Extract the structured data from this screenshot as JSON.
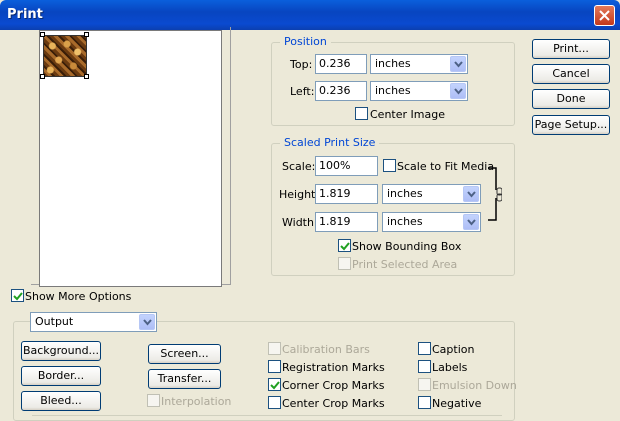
{
  "window": {
    "title": "Print"
  },
  "buttons": {
    "print": "Print...",
    "cancel": "Cancel",
    "done": "Done",
    "page_setup": "Page Setup..."
  },
  "position": {
    "title": "Position",
    "top_label": "Top:",
    "top_value": "0.236",
    "top_unit": "inches",
    "left_label": "Left:",
    "left_value": "0.236",
    "left_unit": "inches",
    "center_image_label": "Center Image",
    "center_image_checked": false
  },
  "scaled": {
    "title": "Scaled Print Size",
    "scale_label": "Scale:",
    "scale_value": "100%",
    "scale_to_fit_label": "Scale to Fit Media",
    "scale_to_fit_checked": false,
    "height_label": "Height:",
    "height_value": "1.819",
    "height_unit": "inches",
    "width_label": "Width:",
    "width_value": "1.819",
    "width_unit": "inches",
    "show_bounding_box_label": "Show Bounding Box",
    "show_bounding_box_checked": true,
    "print_selected_area_label": "Print Selected Area",
    "print_selected_area_checked": false
  },
  "more_options": {
    "label": "Show More Options",
    "checked": true
  },
  "output": {
    "selected": "Output",
    "background": "Background...",
    "border": "Border...",
    "bleed": "Bleed...",
    "screen": "Screen...",
    "transfer": "Transfer...",
    "interpolation": "Interpolation",
    "calibration_bars": "Calibration Bars",
    "registration_marks": "Registration Marks",
    "corner_crop_marks": "Corner Crop Marks",
    "center_crop_marks": "Center Crop Marks",
    "caption": "Caption",
    "labels": "Labels",
    "emulsion_down": "Emulsion Down",
    "negative": "Negative"
  }
}
